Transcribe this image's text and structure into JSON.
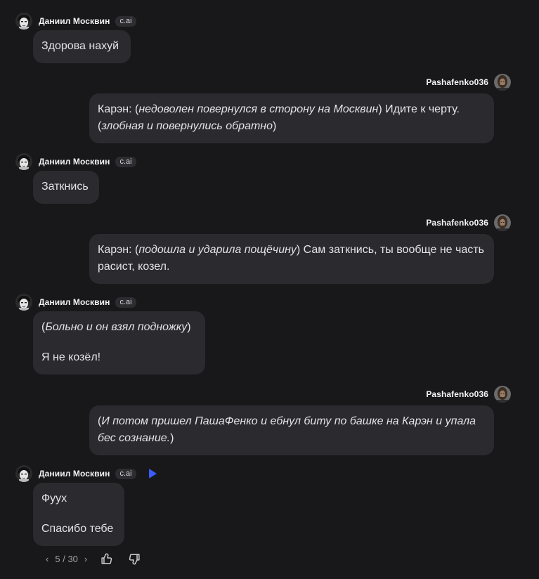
{
  "bot": {
    "name": "Даниил Москвин",
    "tag": "c.ai"
  },
  "user": {
    "name": "Pashafenko036"
  },
  "messages": [
    {
      "parts": [
        {
          "text": "Здорова нахуй"
        }
      ]
    },
    {
      "parts": [
        {
          "text": "Карэн: ("
        },
        {
          "text": "недоволен повернулся в сторону на Москвин",
          "italic": true
        },
        {
          "text": ") Идите к черту. ("
        },
        {
          "text": "злобная и повернулись обратно",
          "italic": true
        },
        {
          "text": ")"
        }
      ]
    },
    {
      "parts": [
        {
          "text": "Заткнись"
        }
      ]
    },
    {
      "parts": [
        {
          "text": "Карэн: ("
        },
        {
          "text": "подошла и ударила пощёчину",
          "italic": true
        },
        {
          "text": ") Сам заткнись, ты вообще не часть расист, козел."
        }
      ]
    },
    {
      "p1": [
        {
          "text": "("
        },
        {
          "text": "Больно и он взял подножку",
          "italic": true
        },
        {
          "text": ")"
        }
      ],
      "p2": "Я не козёл!"
    },
    {
      "parts": [
        {
          "text": "("
        },
        {
          "text": "И потом пришел ПашаФенко и ебнул биту по башке на Карэн и упала бес сознание.",
          "italic": true
        },
        {
          "text": ")"
        }
      ]
    },
    {
      "p1": "Фуух",
      "p2": "Спасибо тебе"
    }
  ],
  "pager": {
    "current": "5",
    "total": "30",
    "separator": "/"
  },
  "icons": {
    "prev": "chevron-left-icon",
    "next": "chevron-right-icon",
    "like": "thumbs-up-icon",
    "dislike": "thumbs-down-icon",
    "play": "play-icon"
  },
  "colors": {
    "background": "#18181b",
    "bubble": "#2a2a2f",
    "accent": "#3b5bff"
  }
}
